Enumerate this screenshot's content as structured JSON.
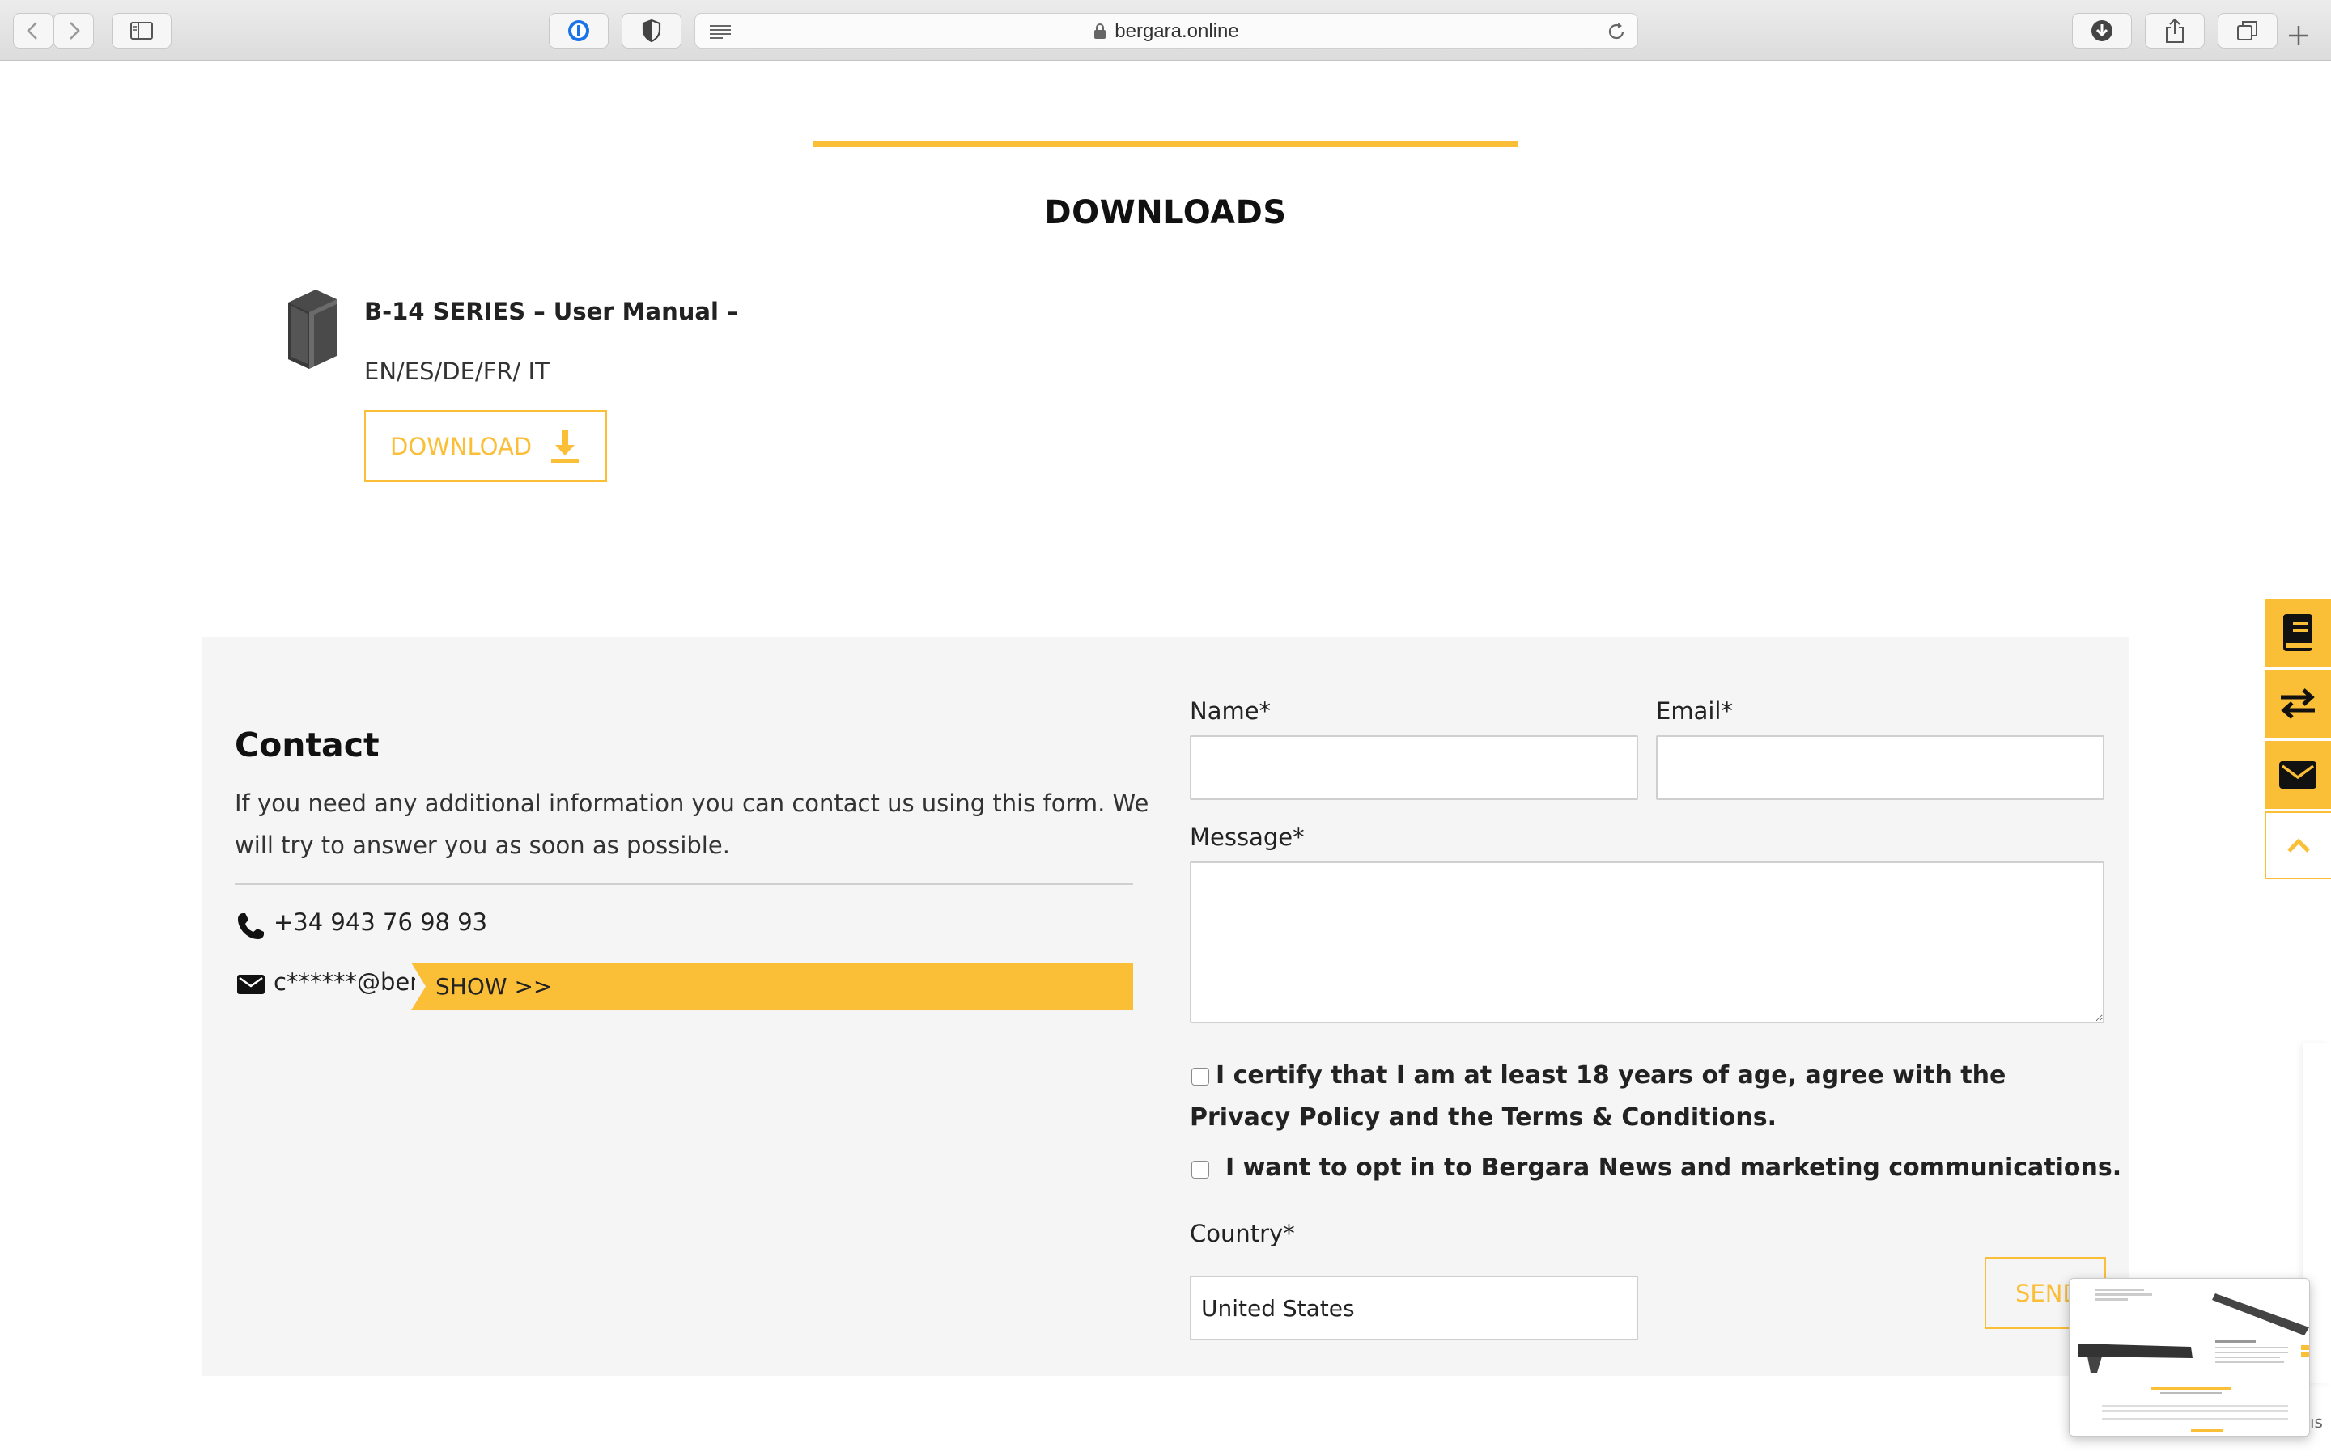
{
  "browser": {
    "url": "bergara.online"
  },
  "downloads": {
    "title": "DOWNLOADS",
    "item_title": "B-14 SERIES – User Manual –",
    "languages": "EN/ES/DE/FR/ IT",
    "download_label": "DOWNLOAD"
  },
  "contact": {
    "title": "Contact",
    "description": "If you need any additional information you can contact us using this form. We will try to answer you as soon as possible.",
    "phone": "+34 943 76 98 93",
    "email_masked": "c******@bergara.online",
    "show_label": "SHOW >>"
  },
  "form": {
    "name_label": "Name*",
    "email_label": "Email*",
    "message_label": "Message*",
    "certify_text": "I certify that I am at least 18 years of age, agree with the Privacy Policy and the Terms & Conditions.",
    "optin_text": "I want to opt in to Bergara News and marketing communications.",
    "country_label": "Country*",
    "country_value": "United States",
    "send_label": "SEND"
  },
  "thumbnail": {
    "edge_text": "ıs"
  },
  "colors": {
    "accent": "#fbbe37",
    "panel_bg": "#f5f5f5"
  },
  "icons": [
    "back-icon",
    "forward-icon",
    "sidebar-icon",
    "password-icon",
    "shield-icon",
    "reader-icon",
    "lock-icon",
    "reload-icon",
    "downloads-icon",
    "share-icon",
    "tabs-icon",
    "new-tab-icon",
    "book-icon",
    "download-arrow-icon",
    "phone-icon",
    "mail-icon",
    "manual-icon",
    "compare-icon",
    "envelope-icon",
    "chevron-up-icon"
  ]
}
